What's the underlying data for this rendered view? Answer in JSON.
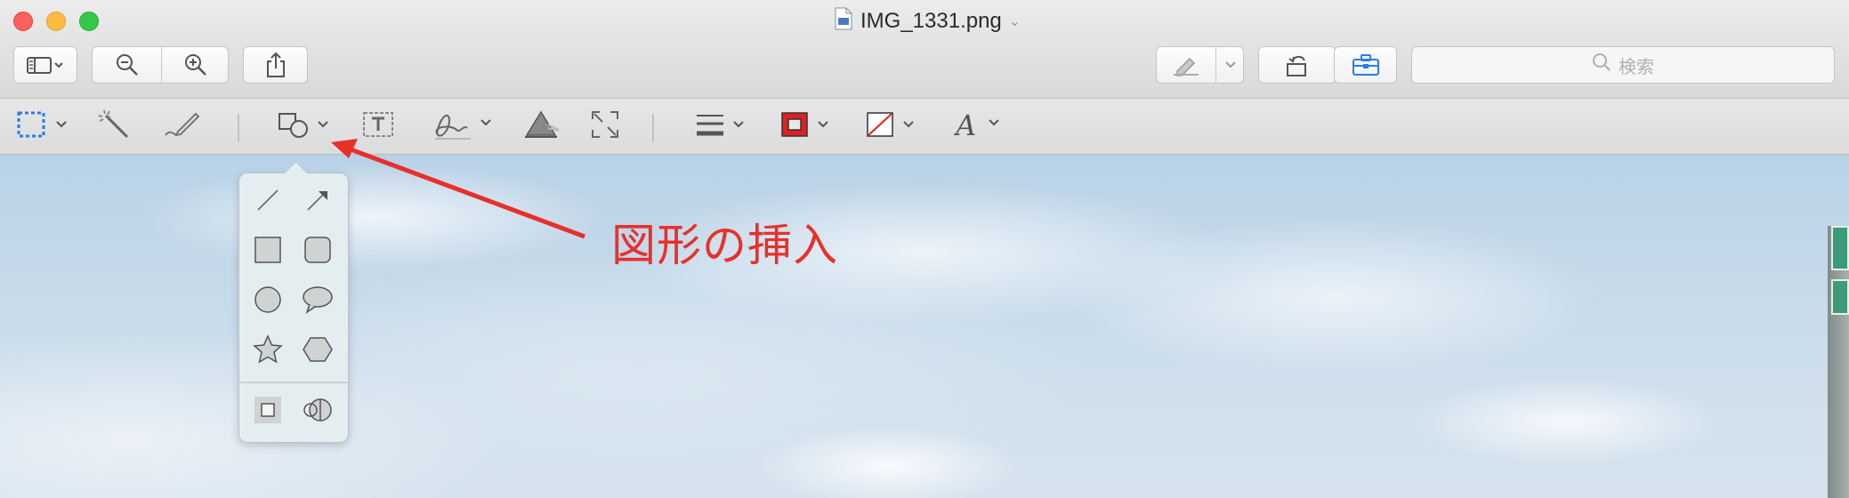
{
  "window": {
    "title": "IMG_1331.png",
    "icons": {
      "close": "close-button",
      "minimize": "minimize-button",
      "zoom": "zoom-button",
      "file": "png-file-icon"
    }
  },
  "toolbar": {
    "sidebar_icon": "sidebar-icon",
    "zoom_out_icon": "zoom-out-icon",
    "zoom_in_icon": "zoom-in-icon",
    "share_icon": "share-icon",
    "highlight_icon": "highlighter-icon",
    "rotate_icon": "rotate-left-icon",
    "markup_icon": "toolbox-icon"
  },
  "search": {
    "placeholder": "検索"
  },
  "markup_bar": {
    "tools": [
      "rect-selection-icon",
      "instant-alpha-icon",
      "sketch-icon",
      "shapes-icon",
      "text-icon",
      "signature-icon",
      "adjust-color-icon",
      "adjust-size-icon",
      "shape-style-icon",
      "border-color-icon",
      "fill-color-icon",
      "text-style-icon"
    ],
    "colors": {
      "border": "#e02020",
      "fill_slash": "#e02020",
      "accent": "#2b7de9"
    }
  },
  "shapes_popover": {
    "items": [
      "line",
      "arrow",
      "rectangle",
      "rounded-rectangle",
      "oval",
      "speech-bubble",
      "star",
      "hexagon",
      "mask",
      "loupe"
    ]
  },
  "annotation": {
    "label": "図形の挿入",
    "color": "#e8302a"
  }
}
